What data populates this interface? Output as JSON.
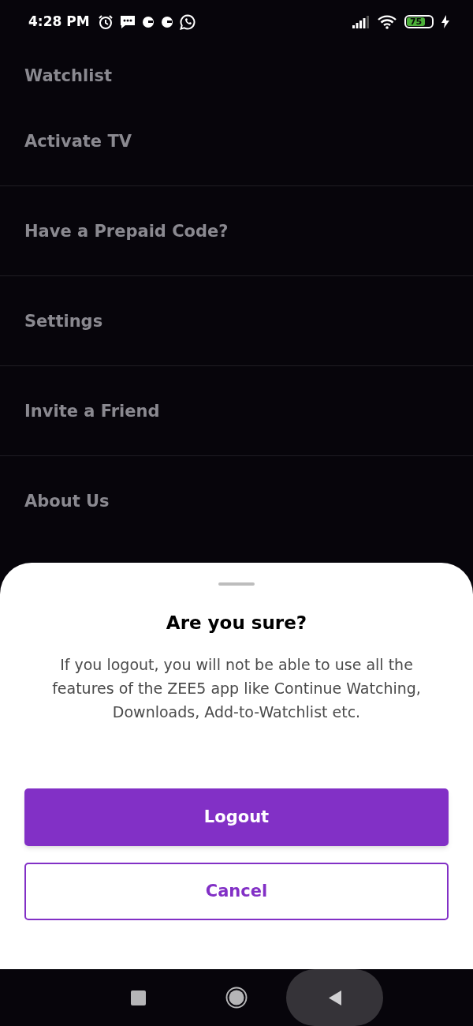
{
  "status_bar": {
    "time": "4:28 PM",
    "battery": "75"
  },
  "menu": {
    "items": [
      {
        "label": "Watchlist",
        "divider_after": false
      },
      {
        "label": "Activate TV",
        "divider_after": true
      },
      {
        "label": "Have a Prepaid Code?",
        "divider_after": true
      },
      {
        "label": "Settings",
        "divider_after": true
      },
      {
        "label": "Invite a Friend",
        "divider_after": true
      },
      {
        "label": "About Us",
        "divider_after": false
      }
    ]
  },
  "dialog": {
    "title": "Are you sure?",
    "message": "If you logout, you will not be able to use all the features of the ZEE5 app like Continue Watching, Downloads, Add-to-Watchlist etc.",
    "buttons": [
      {
        "label": "Logout",
        "kind": "primary"
      },
      {
        "label": "Cancel",
        "kind": "secondary"
      }
    ]
  }
}
